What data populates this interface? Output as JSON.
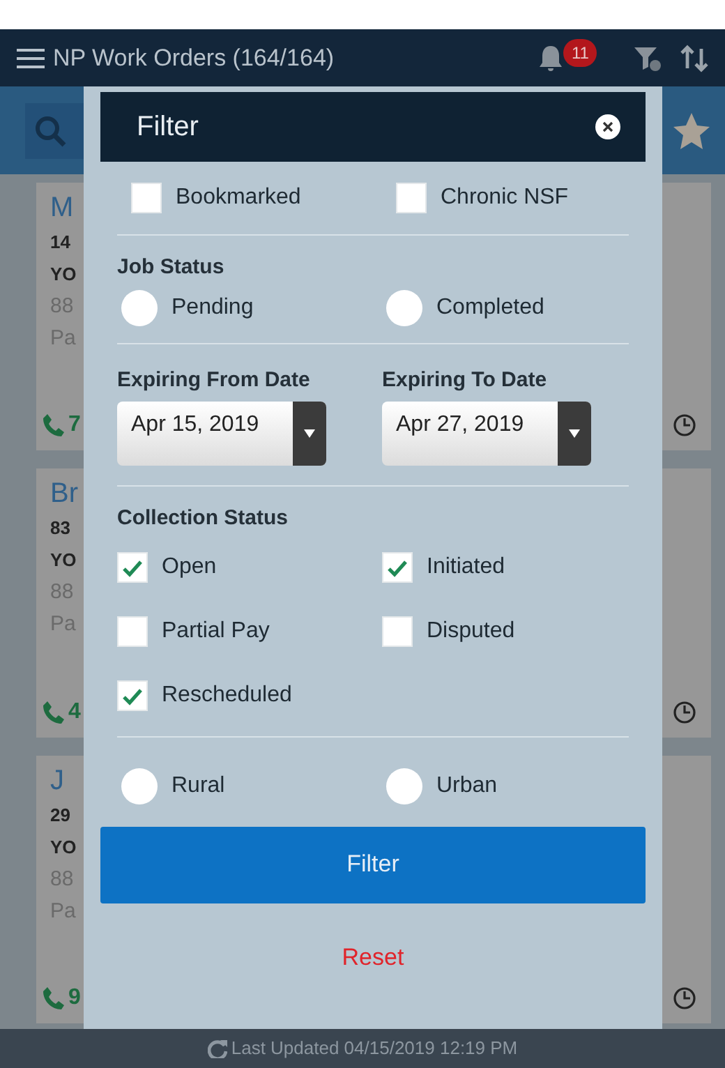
{
  "app_bar": {
    "title": "NP Work Orders (164/164)",
    "notification_count": "11"
  },
  "background_cards": [
    {
      "title": "M",
      "lines": [
        "14",
        "YO",
        "88",
        "Pa"
      ],
      "phone": "7"
    },
    {
      "title": "Br",
      "lines": [
        "83",
        "YO",
        "88",
        "Pa"
      ],
      "phone": "4"
    },
    {
      "title": "J",
      "lines": [
        "29",
        "YO",
        "88",
        "Pa"
      ],
      "phone": "9"
    }
  ],
  "filter_dialog": {
    "title": "Filter",
    "flags": [
      {
        "label": "Bookmarked",
        "checked": false
      },
      {
        "label": "Chronic NSF",
        "checked": false
      }
    ],
    "job_status": {
      "label": "Job Status",
      "options": [
        {
          "label": "Pending",
          "selected": false
        },
        {
          "label": "Completed",
          "selected": false
        }
      ]
    },
    "dates": [
      {
        "label": "Expiring From Date",
        "value": "Apr 15, 2019"
      },
      {
        "label": "Expiring To Date",
        "value": "Apr 27, 2019"
      }
    ],
    "collection_status": {
      "label": "Collection Status",
      "options": [
        {
          "label": "Open",
          "checked": true
        },
        {
          "label": "Initiated",
          "checked": true
        },
        {
          "label": "Partial Pay",
          "checked": false
        },
        {
          "label": "Disputed",
          "checked": false
        },
        {
          "label": "Rescheduled",
          "checked": true
        }
      ]
    },
    "area": [
      {
        "label": "Rural",
        "selected": false
      },
      {
        "label": "Urban",
        "selected": false
      }
    ],
    "filter_button": "Filter",
    "reset_button": "Reset"
  },
  "footer": {
    "text": "Last Updated 04/15/2019 12:19 PM"
  }
}
